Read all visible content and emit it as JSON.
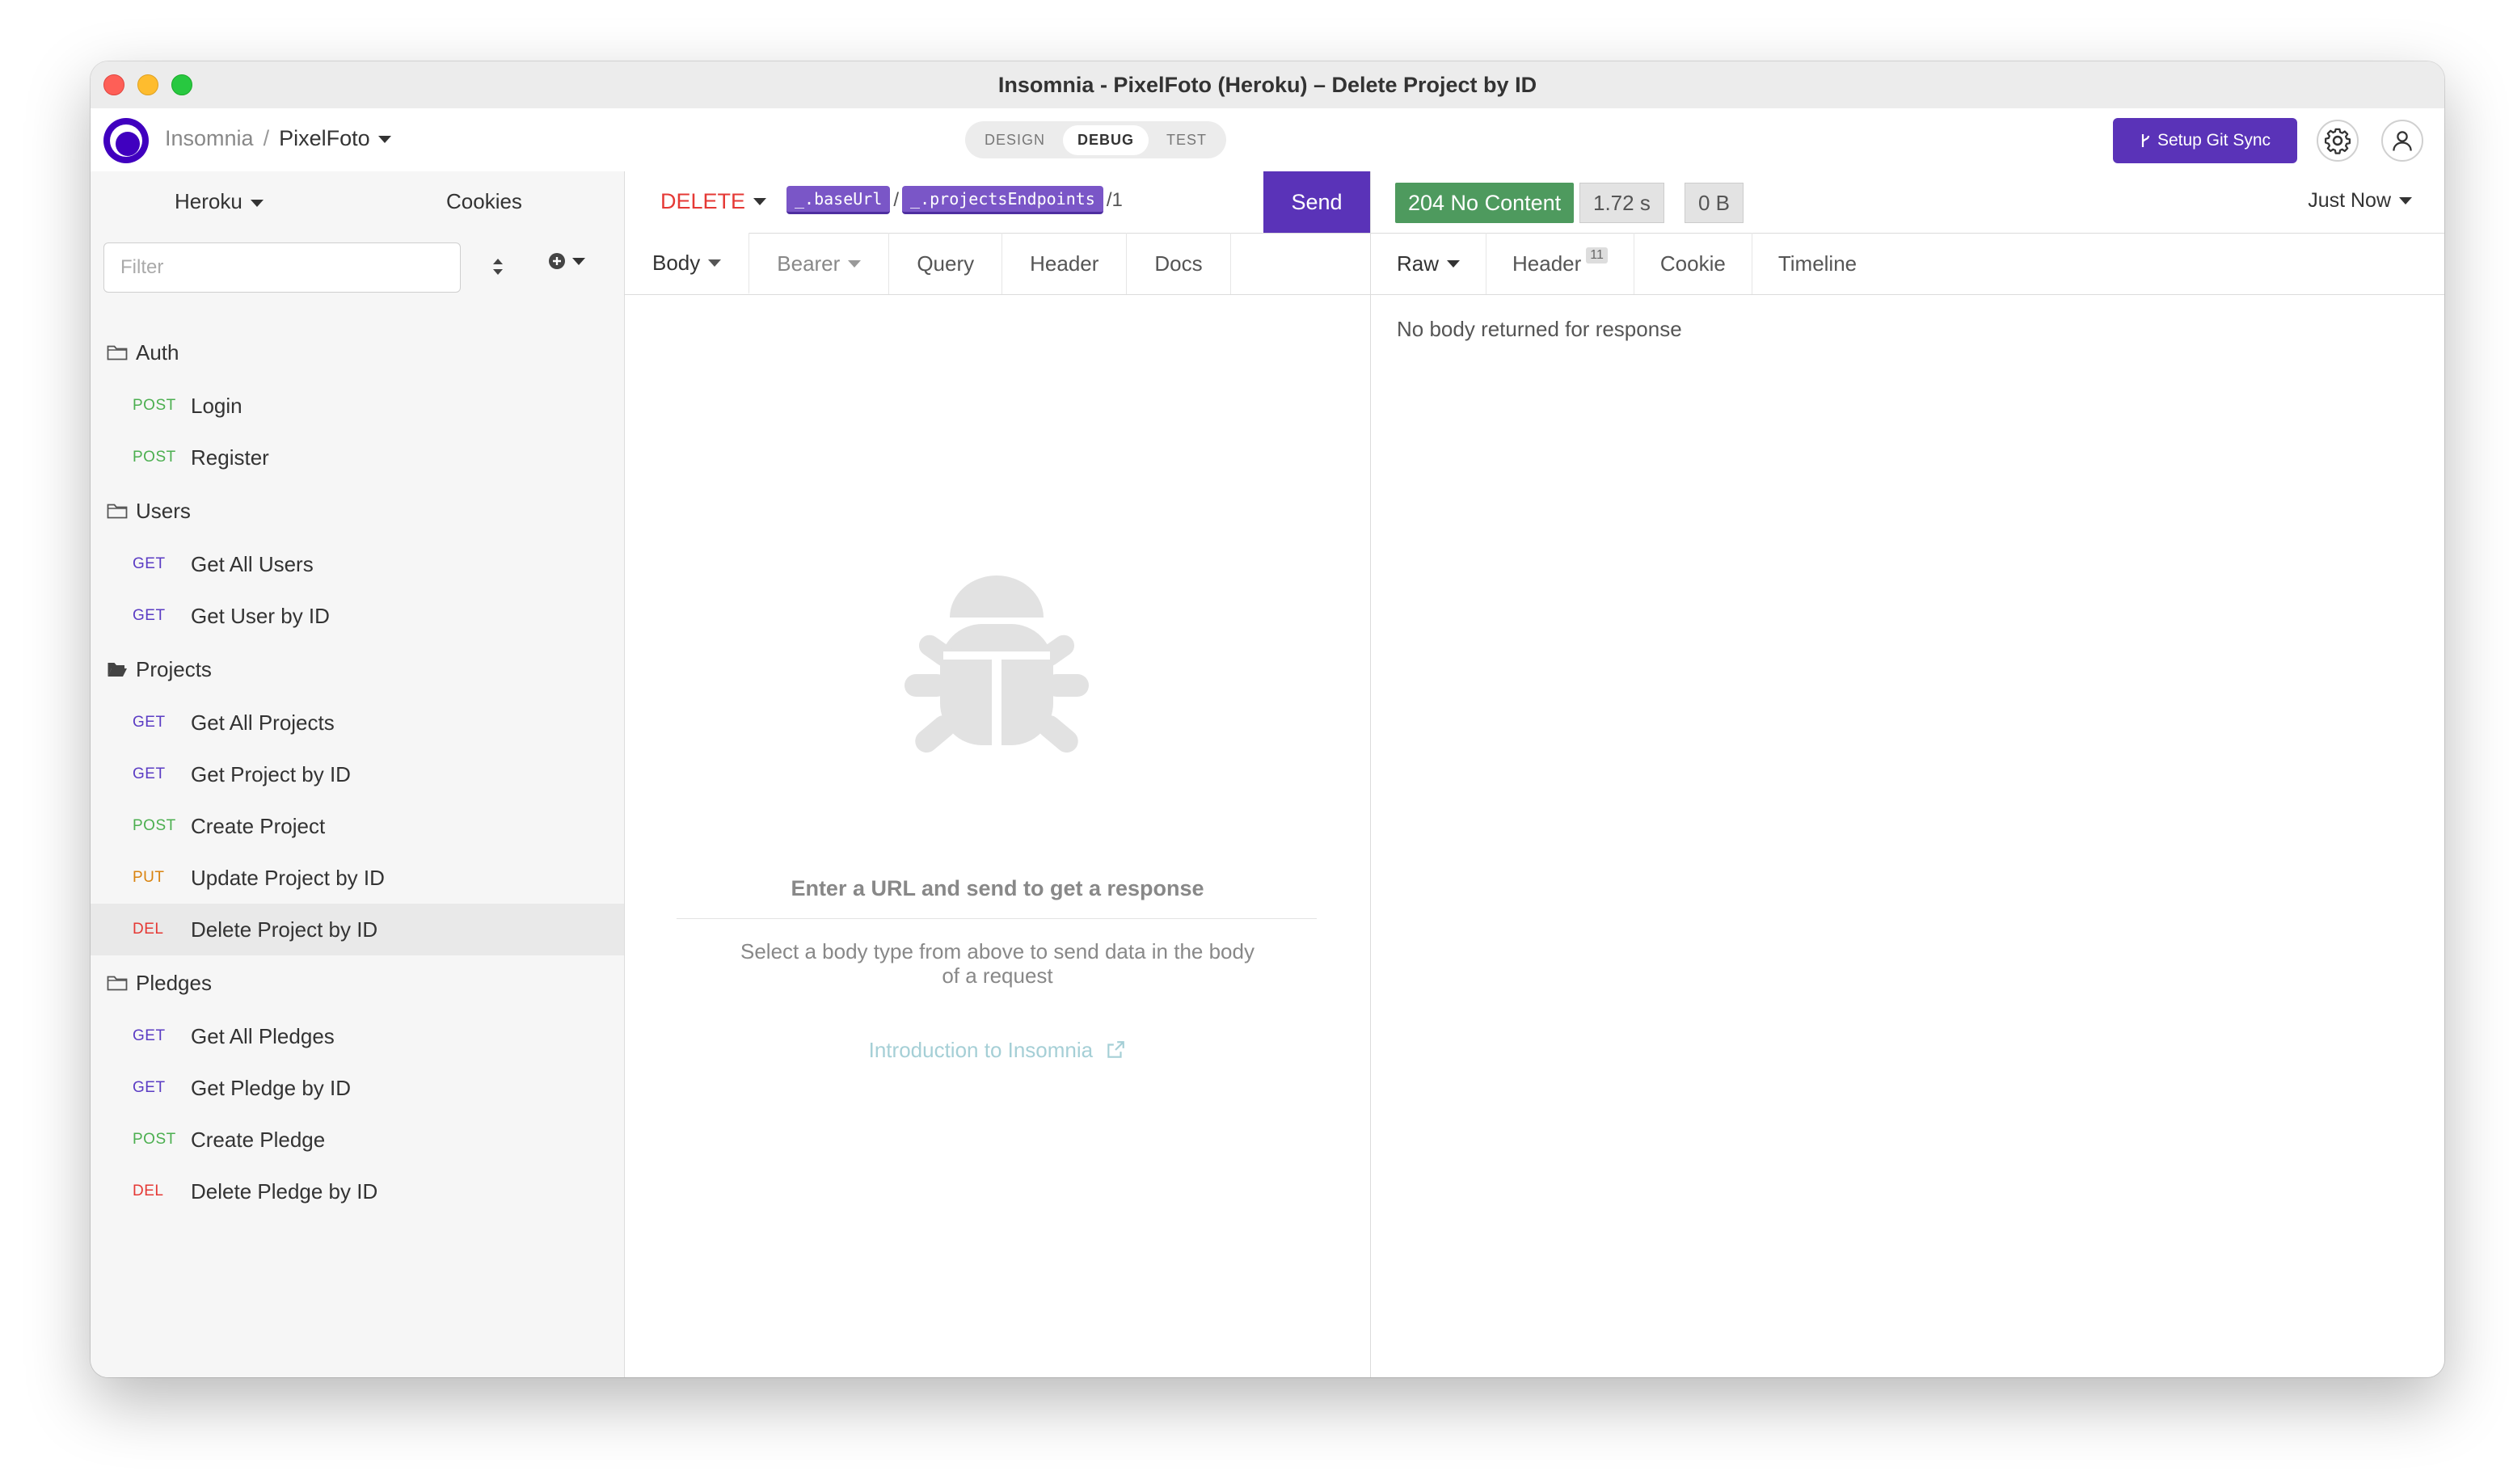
{
  "window": {
    "title": "Insomnia - PixelFoto (Heroku) – Delete Project by ID"
  },
  "header": {
    "breadcrumb_root": "Insomnia",
    "breadcrumb_sep": "/",
    "project": "PixelFoto",
    "modes": [
      "DESIGN",
      "DEBUG",
      "TEST"
    ],
    "active_mode": "DEBUG",
    "git_sync_label": "Setup Git Sync",
    "brand_color": "#5a33b8"
  },
  "sidebar": {
    "environment": "Heroku",
    "cookies_label": "Cookies",
    "filter_placeholder": "Filter",
    "folders": [
      {
        "name": "Auth",
        "open": false,
        "requests": [
          {
            "method": "POST",
            "name": "Login"
          },
          {
            "method": "POST",
            "name": "Register"
          }
        ]
      },
      {
        "name": "Users",
        "open": false,
        "requests": [
          {
            "method": "GET",
            "name": "Get All Users"
          },
          {
            "method": "GET",
            "name": "Get User by ID"
          }
        ]
      },
      {
        "name": "Projects",
        "open": true,
        "requests": [
          {
            "method": "GET",
            "name": "Get All Projects"
          },
          {
            "method": "GET",
            "name": "Get Project by ID"
          },
          {
            "method": "POST",
            "name": "Create Project"
          },
          {
            "method": "PUT",
            "name": "Update Project by ID"
          },
          {
            "method": "DEL",
            "name": "Delete Project by ID",
            "active": true
          }
        ]
      },
      {
        "name": "Pledges",
        "open": false,
        "requests": [
          {
            "method": "GET",
            "name": "Get All Pledges"
          },
          {
            "method": "GET",
            "name": "Get Pledge by ID"
          },
          {
            "method": "POST",
            "name": "Create Pledge"
          },
          {
            "method": "DEL",
            "name": "Delete Pledge by ID"
          }
        ]
      }
    ]
  },
  "request": {
    "method": "DELETE",
    "url_var1": "_.baseUrl",
    "url_sep": "/",
    "url_var2": "_.projectsEndpoints",
    "url_tail": "/1",
    "send_label": "Send",
    "tabs": [
      "Body",
      "Bearer",
      "Query",
      "Header",
      "Docs"
    ],
    "empty_title": "Enter a URL and send to get a response",
    "empty_sub": "Select a body type from above to send data in the body of a request",
    "intro_link": "Introduction to Insomnia"
  },
  "response": {
    "status": "204 No Content",
    "time": "1.72 s",
    "size": "0 B",
    "timestamp": "Just Now",
    "tabs": [
      "Raw",
      "Header",
      "Cookie",
      "Timeline"
    ],
    "header_count": "11",
    "message": "No body returned for response",
    "status_color": "#4e9a5e"
  }
}
